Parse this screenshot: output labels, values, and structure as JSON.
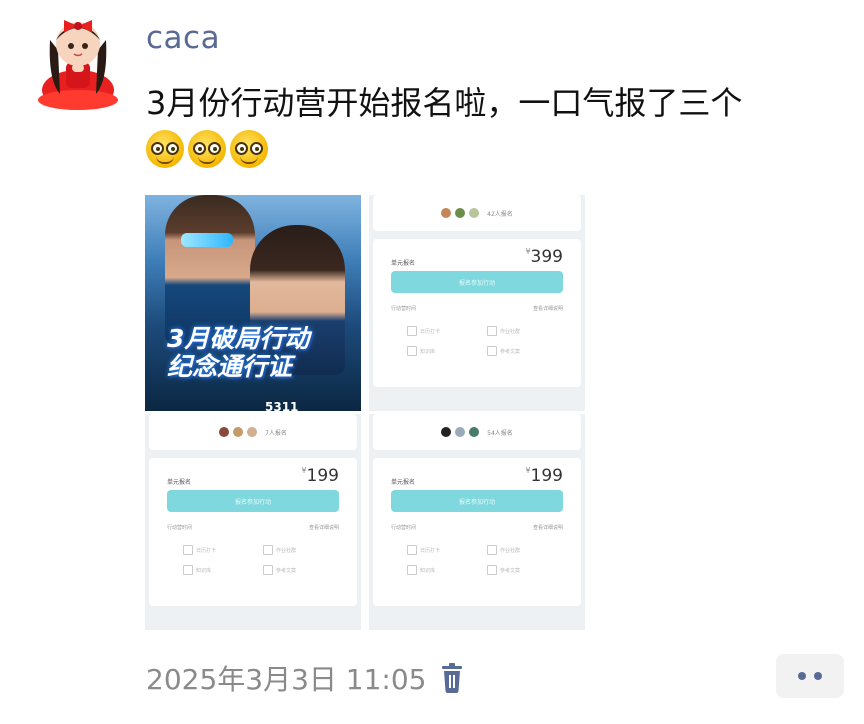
{
  "post": {
    "username": "caca",
    "text": "3月份行动营开始报名啦，一口气报了三个",
    "emojis": [
      "grin-emoji",
      "grin-emoji",
      "grin-emoji"
    ],
    "timestamp": "2025年3月3日 11:05",
    "colors": {
      "username": "#576b95",
      "text": "#111111",
      "meta": "#8a8a8a"
    }
  },
  "images": {
    "poster": {
      "title_line1": "3月破局行动",
      "title_line2": "纪念通行证",
      "code": "5311"
    },
    "cards": [
      {
        "joined": "42人报名",
        "plan": "单元报名",
        "price": "399",
        "currency": "¥",
        "button": "报名参加行动",
        "period": "行动营时间",
        "link": "查看详细说明",
        "features": [
          "日历打卡",
          "作业社群",
          "知识库",
          "参考文案"
        ]
      },
      {
        "joined": "7人报名",
        "plan": "单元报名",
        "price": "199",
        "currency": "¥",
        "button": "报名参加行动",
        "period": "行动营时间",
        "link": "查看详细说明",
        "features": [
          "日历打卡",
          "作业社群",
          "知识库",
          "参考文案"
        ]
      },
      {
        "joined": "54人报名",
        "plan": "单元报名",
        "price": "199",
        "currency": "¥",
        "button": "报名参加行动",
        "period": "行动营时间",
        "link": "查看详细说明",
        "features": [
          "日历打卡",
          "作业社群",
          "知识库",
          "参考文案"
        ]
      }
    ]
  }
}
